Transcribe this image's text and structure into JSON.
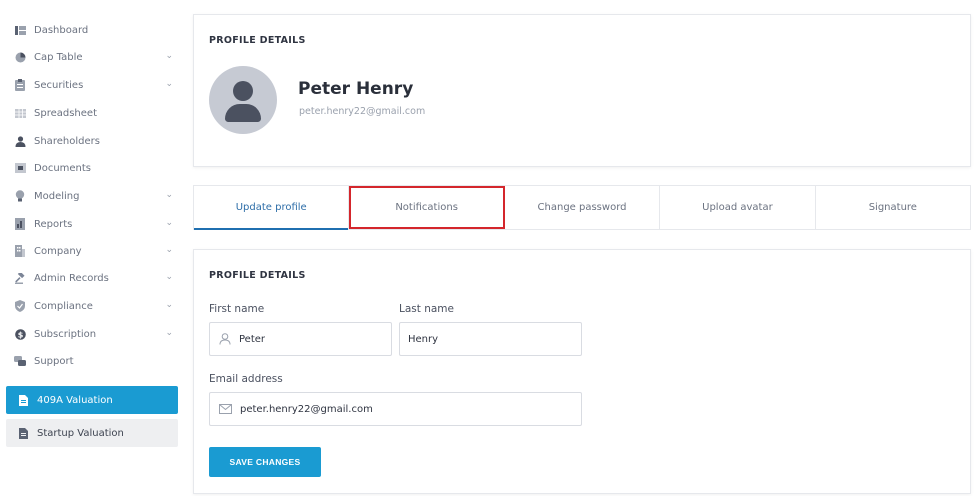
{
  "sidebar": {
    "items": [
      {
        "label": "Dashboard",
        "icon": "dashboard-icon",
        "has_chevron": false
      },
      {
        "label": "Cap Table",
        "icon": "pie-chart-icon",
        "has_chevron": true
      },
      {
        "label": "Securities",
        "icon": "clipboard-icon",
        "has_chevron": true
      },
      {
        "label": "Spreadsheet",
        "icon": "grid-icon",
        "has_chevron": false
      },
      {
        "label": "Shareholders",
        "icon": "person-icon",
        "has_chevron": false
      },
      {
        "label": "Documents",
        "icon": "folder-icon",
        "has_chevron": false
      },
      {
        "label": "Modeling",
        "icon": "lightbulb-icon",
        "has_chevron": true
      },
      {
        "label": "Reports",
        "icon": "report-icon",
        "has_chevron": true
      },
      {
        "label": "Company",
        "icon": "building-icon",
        "has_chevron": true
      },
      {
        "label": "Admin Records",
        "icon": "gavel-icon",
        "has_chevron": true
      },
      {
        "label": "Compliance",
        "icon": "shield-icon",
        "has_chevron": true
      },
      {
        "label": "Subscription",
        "icon": "dollar-icon",
        "has_chevron": true
      },
      {
        "label": "Support",
        "icon": "chat-icon",
        "has_chevron": false
      }
    ],
    "valuation_409a": "409A Valuation",
    "startup_valuation": "Startup Valuation"
  },
  "profile_header": {
    "title": "PROFILE DETAILS",
    "name": "Peter Henry",
    "email": "peter.henry22@gmail.com"
  },
  "tabs": [
    {
      "label": "Update profile",
      "active": true
    },
    {
      "label": "Notifications",
      "active": false,
      "highlighted": true
    },
    {
      "label": "Change password",
      "active": false
    },
    {
      "label": "Upload avatar",
      "active": false
    },
    {
      "label": "Signature",
      "active": false
    }
  ],
  "form": {
    "title": "PROFILE DETAILS",
    "first_name_label": "First name",
    "first_name_value": "Peter",
    "last_name_label": "Last name",
    "last_name_value": "Henry",
    "email_label": "Email address",
    "email_value": "peter.henry22@gmail.com",
    "save_label": "SAVE CHANGES"
  },
  "colors": {
    "accent": "#1a9bd2",
    "highlight_border": "#d4262c",
    "active_tab_underline": "#1f6fb0"
  }
}
